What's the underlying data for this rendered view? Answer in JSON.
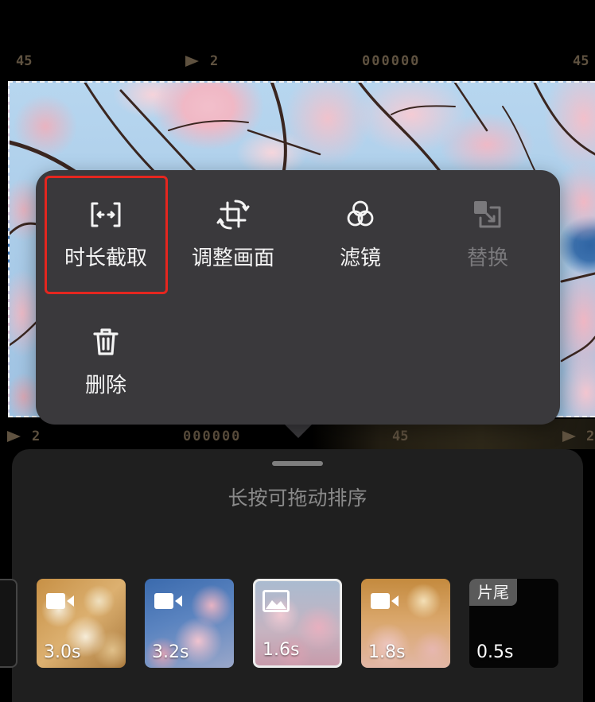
{
  "film_strip": {
    "top": {
      "left_number": "45",
      "frame_number": "2",
      "counter": "000000",
      "right_number": "45"
    },
    "bottom": {
      "frame_number": "2",
      "counter": "000000",
      "number": "45",
      "right_frame_number": "2"
    },
    "marker_icon": "play-marker-icon"
  },
  "context_menu": {
    "items": [
      {
        "label": "时长截取",
        "icon": "trim-duration-icon",
        "enabled": true,
        "highlighted": true
      },
      {
        "label": "调整画面",
        "icon": "crop-rotate-icon",
        "enabled": true,
        "highlighted": false
      },
      {
        "label": "滤镜",
        "icon": "filter-icon",
        "enabled": true,
        "highlighted": false
      },
      {
        "label": "替换",
        "icon": "replace-icon",
        "enabled": false,
        "highlighted": false
      },
      {
        "label": "删除",
        "icon": "trash-icon",
        "enabled": true,
        "highlighted": false
      }
    ]
  },
  "clip_sheet": {
    "hint": "长按可拖动排序",
    "clips": [
      {
        "icon": "video-icon",
        "duration": "3.0s",
        "selected": false
      },
      {
        "icon": "video-icon",
        "duration": "3.2s",
        "selected": false
      },
      {
        "icon": "image-icon",
        "duration": "1.6s",
        "selected": true
      },
      {
        "icon": "video-icon",
        "duration": "1.8s",
        "selected": false
      },
      {
        "tag": "片尾",
        "duration": "0.5s",
        "selected": false
      }
    ]
  },
  "colors": {
    "highlight_box": "#e5261f",
    "popup_background": "#3a393c",
    "sheet_background": "#1f1f1f",
    "hint_text": "#8a8a8a",
    "disabled_text": "#7a797c",
    "film_marker": "#5f5240",
    "selected_border": "#ececec"
  }
}
